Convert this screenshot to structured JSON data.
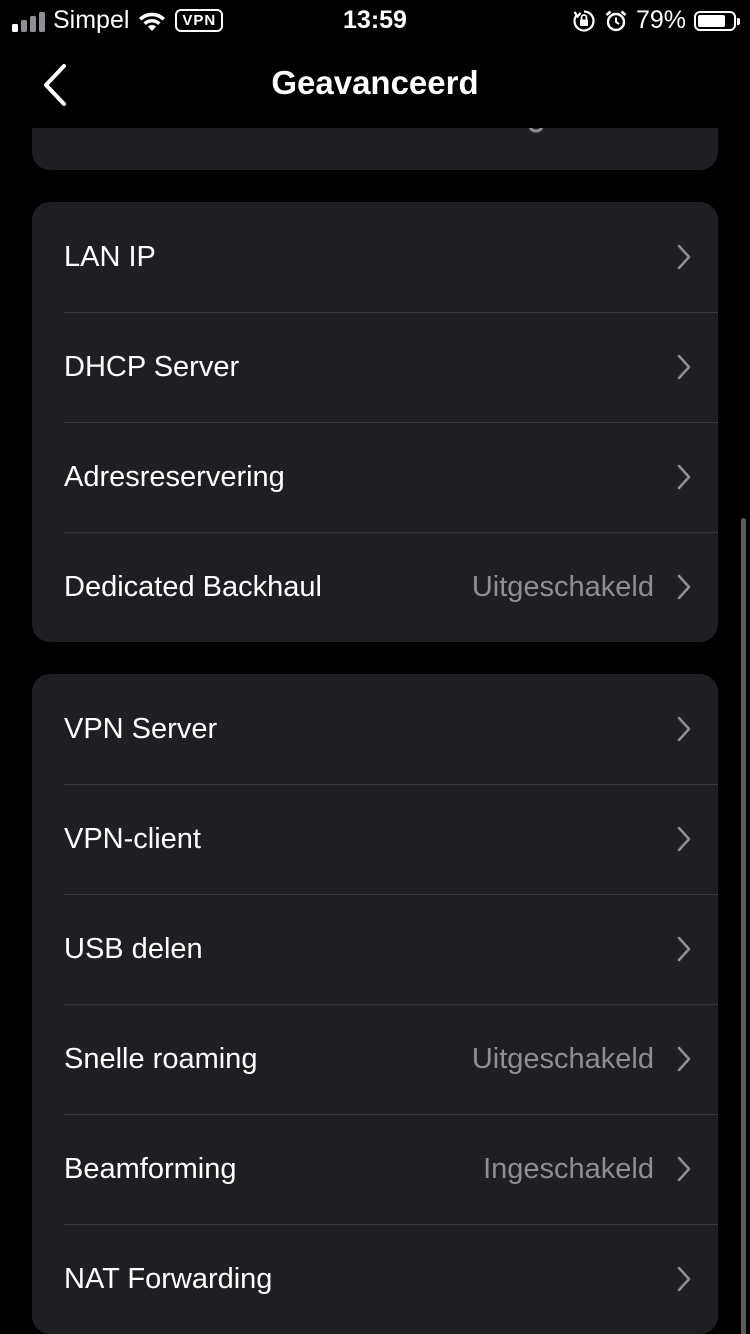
{
  "status_bar": {
    "carrier": "Simpel",
    "vpn": "VPN",
    "time": "13:59",
    "battery": "79%",
    "battery_level": 0.79
  },
  "nav": {
    "title": "Geavanceerd"
  },
  "groups": [
    {
      "rows": [
        {
          "label": "LAN IP",
          "value": ""
        },
        {
          "label": "DHCP Server",
          "value": ""
        },
        {
          "label": "Adresreservering",
          "value": ""
        },
        {
          "label": "Dedicated Backhaul",
          "value": "Uitgeschakeld"
        }
      ]
    },
    {
      "rows": [
        {
          "label": "VPN Server",
          "value": ""
        },
        {
          "label": "VPN-client",
          "value": ""
        },
        {
          "label": "USB delen",
          "value": ""
        },
        {
          "label": "Snelle roaming",
          "value": "Uitgeschakeld"
        },
        {
          "label": "Beamforming",
          "value": "Ingeschakeld"
        },
        {
          "label": "NAT Forwarding",
          "value": ""
        }
      ]
    }
  ],
  "colors": {
    "background": "#000000",
    "card": "#1f1f23",
    "separator": "#38383c",
    "secondary_text": "#8e8e93"
  }
}
